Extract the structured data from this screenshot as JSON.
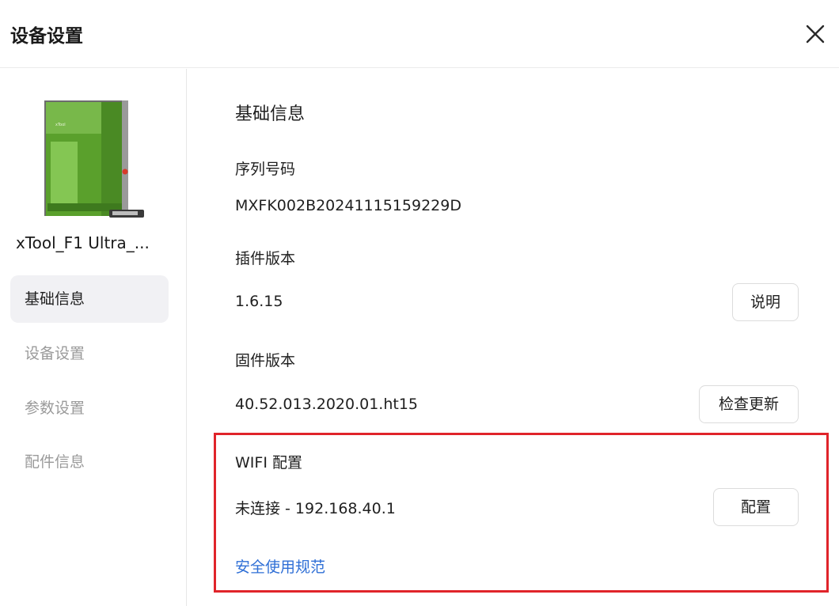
{
  "header": {
    "title": "设备设置"
  },
  "sidebar": {
    "device_name": "xTool_F1 Ultra_...",
    "items": [
      {
        "label": "基础信息"
      },
      {
        "label": "设备设置"
      },
      {
        "label": "参数设置"
      },
      {
        "label": "配件信息"
      }
    ]
  },
  "main": {
    "section_title": "基础信息",
    "serial": {
      "label": "序列号码",
      "value": "MXFK002B20241115159229D"
    },
    "plugin": {
      "label": "插件版本",
      "value": "1.6.15",
      "button": "说明"
    },
    "firmware": {
      "label": "固件版本",
      "value": "40.52.013.2020.01.ht15",
      "button": "检查更新"
    },
    "wifi": {
      "label": "WIFI 配置",
      "value": "未连接 - 192.168.40.1",
      "button": "配置"
    },
    "safety_link": "安全使用规范"
  },
  "colors": {
    "accent_link": "#2f6fd6",
    "highlight_border": "#e0242a",
    "device_green": "#5aa02c"
  }
}
